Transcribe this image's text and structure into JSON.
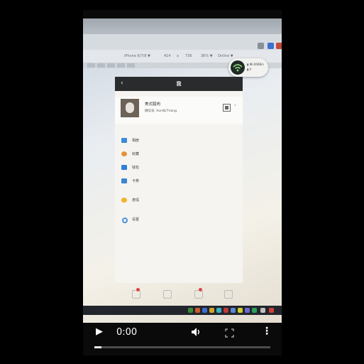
{
  "browser": {
    "toolbar_device": "iPhone 6/7/8 ▼",
    "toolbar_width": "414",
    "toolbar_x": "x",
    "toolbar_height": "736",
    "toolbar_zoom": "36% ▼",
    "toolbar_throttle": "Online ▼"
  },
  "wifi_popup": {
    "line1": "▮ 86.00KB/s",
    "line2": "▮ 0"
  },
  "app": {
    "back_label": "‹",
    "title": "我",
    "profile_name": "美式腊肉",
    "profile_id": "微信号: hordk/7nang",
    "qr_icon": "qr-code-icon",
    "chevron": "›",
    "menu": [
      {
        "label": "相册",
        "icon": "photo-album-icon",
        "color": "#3c8bd9"
      },
      {
        "label": "收藏",
        "icon": "favorites-icon",
        "color": "#e6913a"
      },
      {
        "label": "钱包",
        "icon": "wallet-icon",
        "color": "#2f7ed8"
      },
      {
        "label": "卡券",
        "icon": "card-icon",
        "color": "#3a86d4"
      },
      {
        "label": "表情",
        "icon": "emoji-icon",
        "color": "#f0b429"
      },
      {
        "label": "设置",
        "icon": "settings-icon",
        "color": "#4a90d9"
      }
    ]
  },
  "player": {
    "time": "0:00",
    "progress": 0.04
  },
  "colors": {
    "background": "#000000",
    "nav_bar": "#2a2b2d",
    "notification": "#e04444"
  }
}
